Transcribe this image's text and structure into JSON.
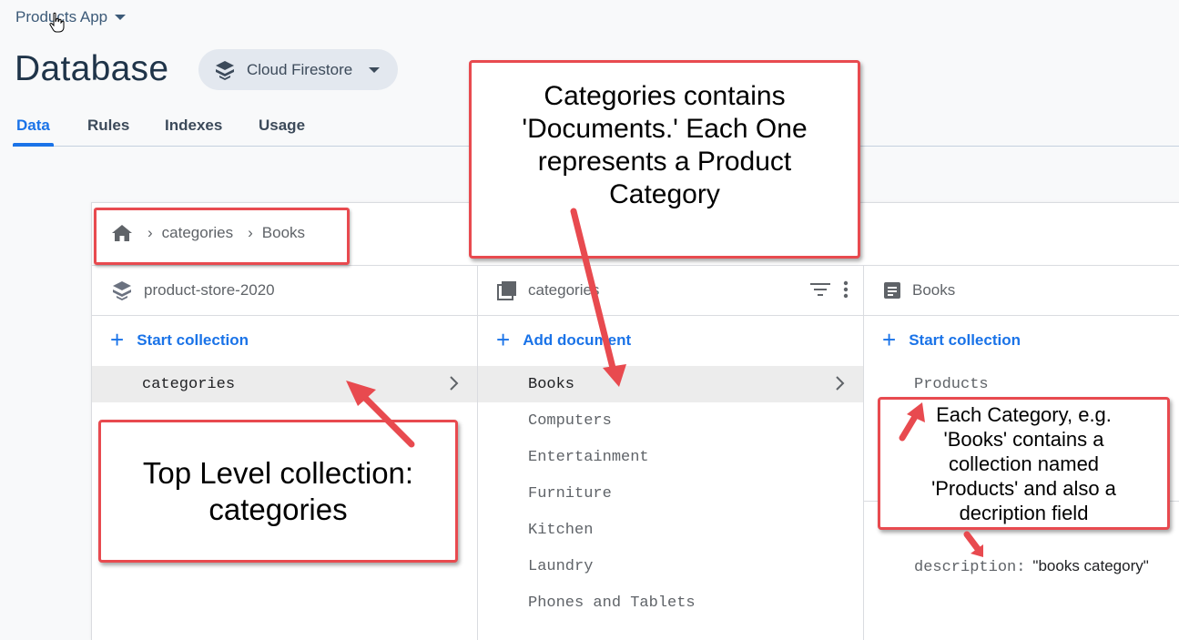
{
  "header": {
    "app_name": "Products App",
    "page_title": "Database",
    "db_selector": "Cloud Firestore"
  },
  "tabs": [
    {
      "label": "Data",
      "active": true
    },
    {
      "label": "Rules"
    },
    {
      "label": "Indexes"
    },
    {
      "label": "Usage"
    }
  ],
  "breadcrumb": [
    "categories",
    "Books"
  ],
  "columns": {
    "root": {
      "title": "product-store-2020",
      "action": "Start collection",
      "items": [
        "categories"
      ]
    },
    "collection": {
      "title": "categories",
      "action": "Add document",
      "items": [
        "Books",
        "Computers",
        "Entertainment",
        "Furniture",
        "Kitchen",
        "Laundry",
        "Phones and Tablets"
      ]
    },
    "document": {
      "title": "Books",
      "action": "Start collection",
      "items": [
        "Products"
      ],
      "fields": [
        {
          "key": "description:",
          "value": "\"books category\""
        }
      ]
    }
  },
  "annotations": {
    "top_level": "Top Level collection: categories",
    "documents": "Categories contains 'Documents.' Each One represents a Product Category",
    "each_category": "Each Category, e.g. 'Books' contains a collection named 'Products' and also a decription field"
  },
  "colors": {
    "accent": "#1a73e8",
    "annotation_border": "#e84a4f",
    "arrow": "#e84a4f"
  }
}
